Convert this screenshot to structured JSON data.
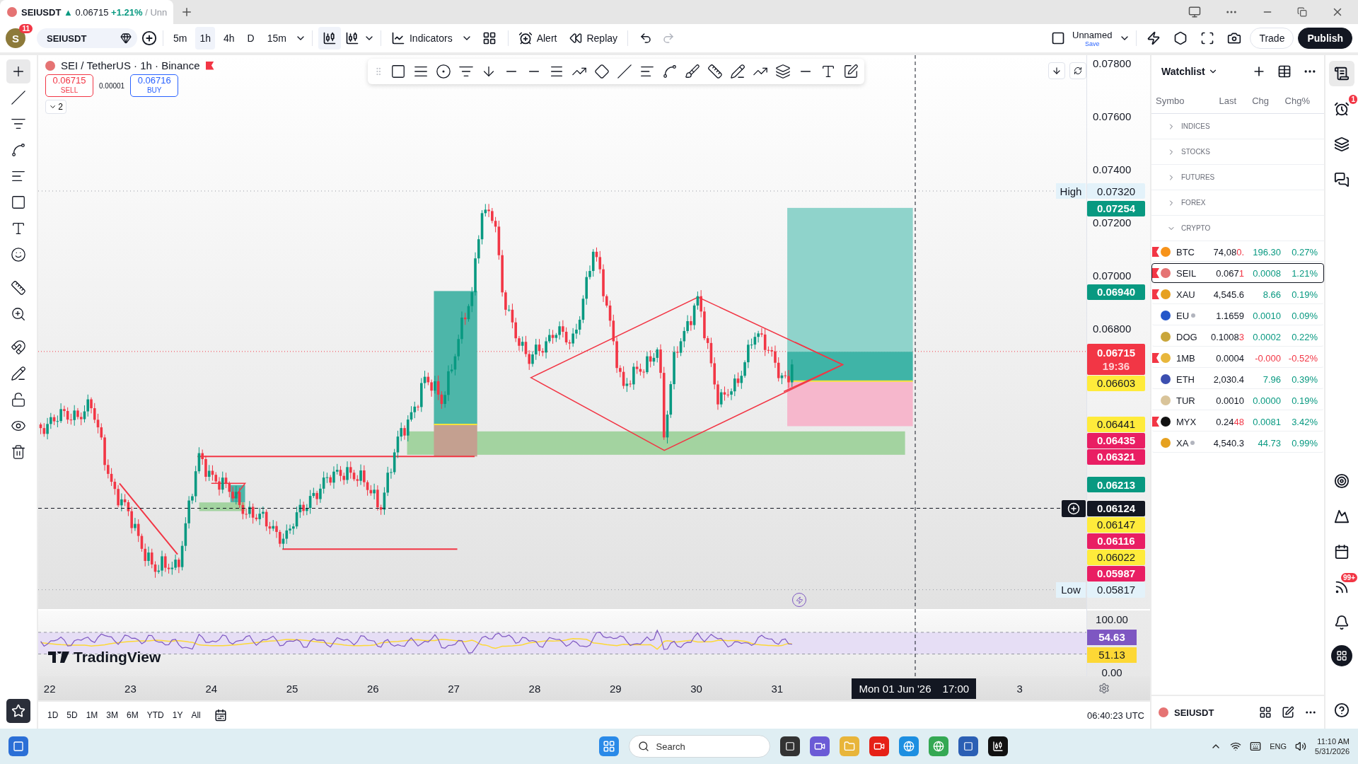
{
  "browser_tab": {
    "symbol": "SEIUSDT",
    "arrow": "▲",
    "price": "0.06715",
    "change": "+1.21%",
    "rest": "/ Unn"
  },
  "top_bar": {
    "avatar": "S",
    "avatar_badge": "11",
    "symbol": "SEIUSDT",
    "timeframes": [
      {
        "label": "5m",
        "selected": false
      },
      {
        "label": "1h",
        "selected": true
      },
      {
        "label": "4h",
        "selected": false
      },
      {
        "label": "D",
        "selected": false
      },
      {
        "label": "15m",
        "selected": false
      }
    ],
    "indicators": "Indicators",
    "alert": "Alert",
    "replay": "Replay",
    "layout_name": "Unnamed",
    "save": "Save",
    "trade": "Trade",
    "publish": "Publish"
  },
  "left_tools": [
    {
      "kind": "crosshair",
      "selected": true
    },
    {
      "kind": "trend",
      "selected": false
    },
    {
      "kind": "fib",
      "selected": false
    },
    {
      "kind": "pattern",
      "selected": false
    },
    {
      "kind": "projection",
      "selected": false
    },
    {
      "kind": "shape",
      "selected": false
    },
    {
      "kind": "text",
      "selected": false
    },
    {
      "kind": "emoji",
      "selected": false
    },
    {
      "kind": "ruler",
      "selected": false
    },
    {
      "kind": "zoom",
      "selected": false
    },
    {
      "kind": "magnet",
      "selected": false
    },
    {
      "kind": "lockdraw",
      "selected": false
    },
    {
      "kind": "lock",
      "selected": false
    },
    {
      "kind": "eye",
      "selected": false
    },
    {
      "kind": "trash",
      "selected": false
    }
  ],
  "legend": {
    "title": "SEI / TetherUS · 1h · Binance",
    "sell_price": "0.06715",
    "sell": "SELL",
    "spread": "0.00001",
    "buy_price": "0.06716",
    "buy": "BUY",
    "collapse": "2"
  },
  "price_scale": [
    "0.07800",
    "0.07600",
    "0.07400",
    "0.07200",
    "0.07000",
    "0.06800"
  ],
  "price_labels": [
    {
      "text": "0.07320",
      "kind": "high",
      "tag": "High"
    },
    {
      "text": "0.07254",
      "kind": "green"
    },
    {
      "text": "0.06940",
      "kind": "green"
    },
    {
      "text": "0.06715",
      "kind": "last",
      "timer": "19:36"
    },
    {
      "text": "0.06603",
      "kind": "yellow"
    },
    {
      "text": "0.06441",
      "kind": "yellow"
    },
    {
      "text": "0.06435",
      "kind": "pink"
    },
    {
      "text": "0.06321",
      "kind": "pink"
    },
    {
      "text": "0.06213",
      "kind": "green"
    },
    {
      "text": "0.06124",
      "kind": "crosshair"
    },
    {
      "text": "0.06147",
      "kind": "yellow"
    },
    {
      "text": "0.06116",
      "kind": "pink"
    },
    {
      "text": "0.06022",
      "kind": "yellow"
    },
    {
      "text": "0.05987",
      "kind": "pink"
    },
    {
      "text": "0.05817",
      "kind": "low",
      "tag": "Low"
    }
  ],
  "rsi_scale": [
    {
      "text": "100.00",
      "kind": "scale"
    },
    {
      "text": "54.63",
      "kind": "rsi"
    },
    {
      "text": "51.13",
      "kind": "average"
    },
    {
      "text": "0.00",
      "kind": "scale"
    }
  ],
  "logo": "TradingView",
  "time_axis": {
    "dates": [
      "22",
      "23",
      "24",
      "25",
      "26",
      "27",
      "28",
      "29",
      "30",
      "31"
    ],
    "crosshair_date": "Mon 01 Jun '26",
    "crosshair_time": "17:00",
    "after": [
      "3"
    ]
  },
  "ranges": [
    "1D",
    "5D",
    "1M",
    "3M",
    "6M",
    "YTD",
    "1Y",
    "All"
  ],
  "clock": "06:40:23 UTC",
  "watchlist": {
    "title": "Watchlist",
    "columns": [
      "Symbo",
      "Last",
      "Chg",
      "Chg%"
    ],
    "groups": [
      {
        "label": "INDICES",
        "expanded": false
      },
      {
        "label": "STOCKS",
        "expanded": false
      },
      {
        "label": "FUTURES",
        "expanded": false
      },
      {
        "label": "FOREX",
        "expanded": false
      },
      {
        "label": "CRYPTO",
        "expanded": true
      }
    ],
    "rows": [
      {
        "symbol": "BTC",
        "color": "#f7931a",
        "last": "74,08",
        "flash": "0.",
        "chg": "196.30",
        "pct": "0.27%",
        "down": false,
        "flagged": true,
        "dot": false,
        "selected": false
      },
      {
        "symbol": "SEIL",
        "color": "#e57373",
        "last": "0.067",
        "flash": "1",
        "chg": "0.0008",
        "pct": "1.21%",
        "down": false,
        "flagged": true,
        "dot": false,
        "selected": true
      },
      {
        "symbol": "XAU",
        "color": "#e6a11f",
        "last": "4,545.6",
        "chg": "8.66",
        "pct": "0.19%",
        "down": false,
        "flagged": true,
        "dot": false,
        "selected": false
      },
      {
        "symbol": "EU",
        "color": "#2456c9",
        "last": "1.1659",
        "chg": "0.0010",
        "pct": "0.09%",
        "down": false,
        "flagged": false,
        "dot": true,
        "selected": false
      },
      {
        "symbol": "DOG",
        "color": "#c9a63b",
        "last": "0.1008",
        "flash": "3",
        "chg": "0.0002",
        "pct": "0.22%",
        "down": false,
        "flagged": false,
        "dot": false,
        "selected": false
      },
      {
        "symbol": "1MB",
        "color": "#e8b73c",
        "last": "0.0004",
        "chg": "-0.000",
        "pct": "-0.52%",
        "down": true,
        "flagged": true,
        "dot": false,
        "selected": false
      },
      {
        "symbol": "ETH",
        "color": "#3c4fb0",
        "last": "2,030.4",
        "chg": "7.96",
        "pct": "0.39%",
        "down": false,
        "flagged": false,
        "dot": false,
        "selected": false
      },
      {
        "symbol": "TUR",
        "color": "#d9c49a",
        "last": "0.0010",
        "chg": "0.0000",
        "pct": "0.19%",
        "down": false,
        "flagged": false,
        "dot": false,
        "selected": false
      },
      {
        "symbol": "MYX",
        "color": "#111111",
        "last": "0.24",
        "flash": "48",
        "chg": "0.0081",
        "pct": "3.42%",
        "down": false,
        "flagged": true,
        "dot": false,
        "selected": false
      },
      {
        "symbol": "XA",
        "color": "#e6a11f",
        "last": "4,540.3",
        "chg": "44.73",
        "pct": "0.99%",
        "down": false,
        "flagged": false,
        "dot": true,
        "selected": false
      }
    ],
    "footer_symbol": "SEIUSDT"
  },
  "sidebar_badges": {
    "alerts": "1",
    "notifications": "99+"
  },
  "taskbar": {
    "search": "Search",
    "language": "ENG",
    "time": "11:10 AM",
    "date": "5/31/2026"
  }
}
